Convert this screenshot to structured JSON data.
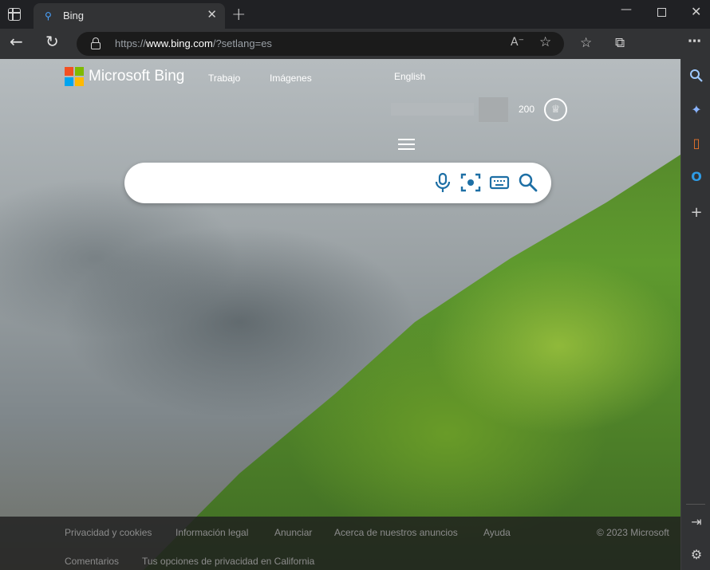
{
  "browser": {
    "tab": {
      "title": "Bing",
      "favicon": "bing-search-icon"
    },
    "new_tab_label": "+",
    "url_prefix": "https://",
    "url_host": "www.bing.com",
    "url_path": "/?setlang=es",
    "nav_icons": [
      "back-arrow-icon",
      "refresh-icon",
      "lock-icon",
      "read-aloud-icon",
      "add-favorite-icon",
      "favorites-icon",
      "collections-icon",
      "more-icon"
    ]
  },
  "bing": {
    "brand": "Microsoft Bing",
    "nav": {
      "trabajo": "Trabajo",
      "imagenes": "Imágenes"
    },
    "language_link": "English",
    "rewards_points": "200",
    "search": {
      "placeholder": ""
    }
  },
  "footer": {
    "links_row1": [
      "Privacidad y cookies",
      "Información legal",
      "Anunciar",
      "Acerca de nuestros anuncios",
      "Ayuda"
    ],
    "copyright": "© 2023 Microsoft",
    "links_row2": [
      "Comentarios",
      "Tus opciones de privacidad en California"
    ]
  },
  "sidebar": {
    "icons": [
      "search-icon",
      "copilot-icon",
      "office-icon",
      "outlook-icon",
      "add-icon",
      "hide-sidebar-icon",
      "settings-icon"
    ]
  },
  "colors": {
    "accent": "#1d6fa5",
    "chrome": "#323335",
    "titlebar": "#202124"
  }
}
